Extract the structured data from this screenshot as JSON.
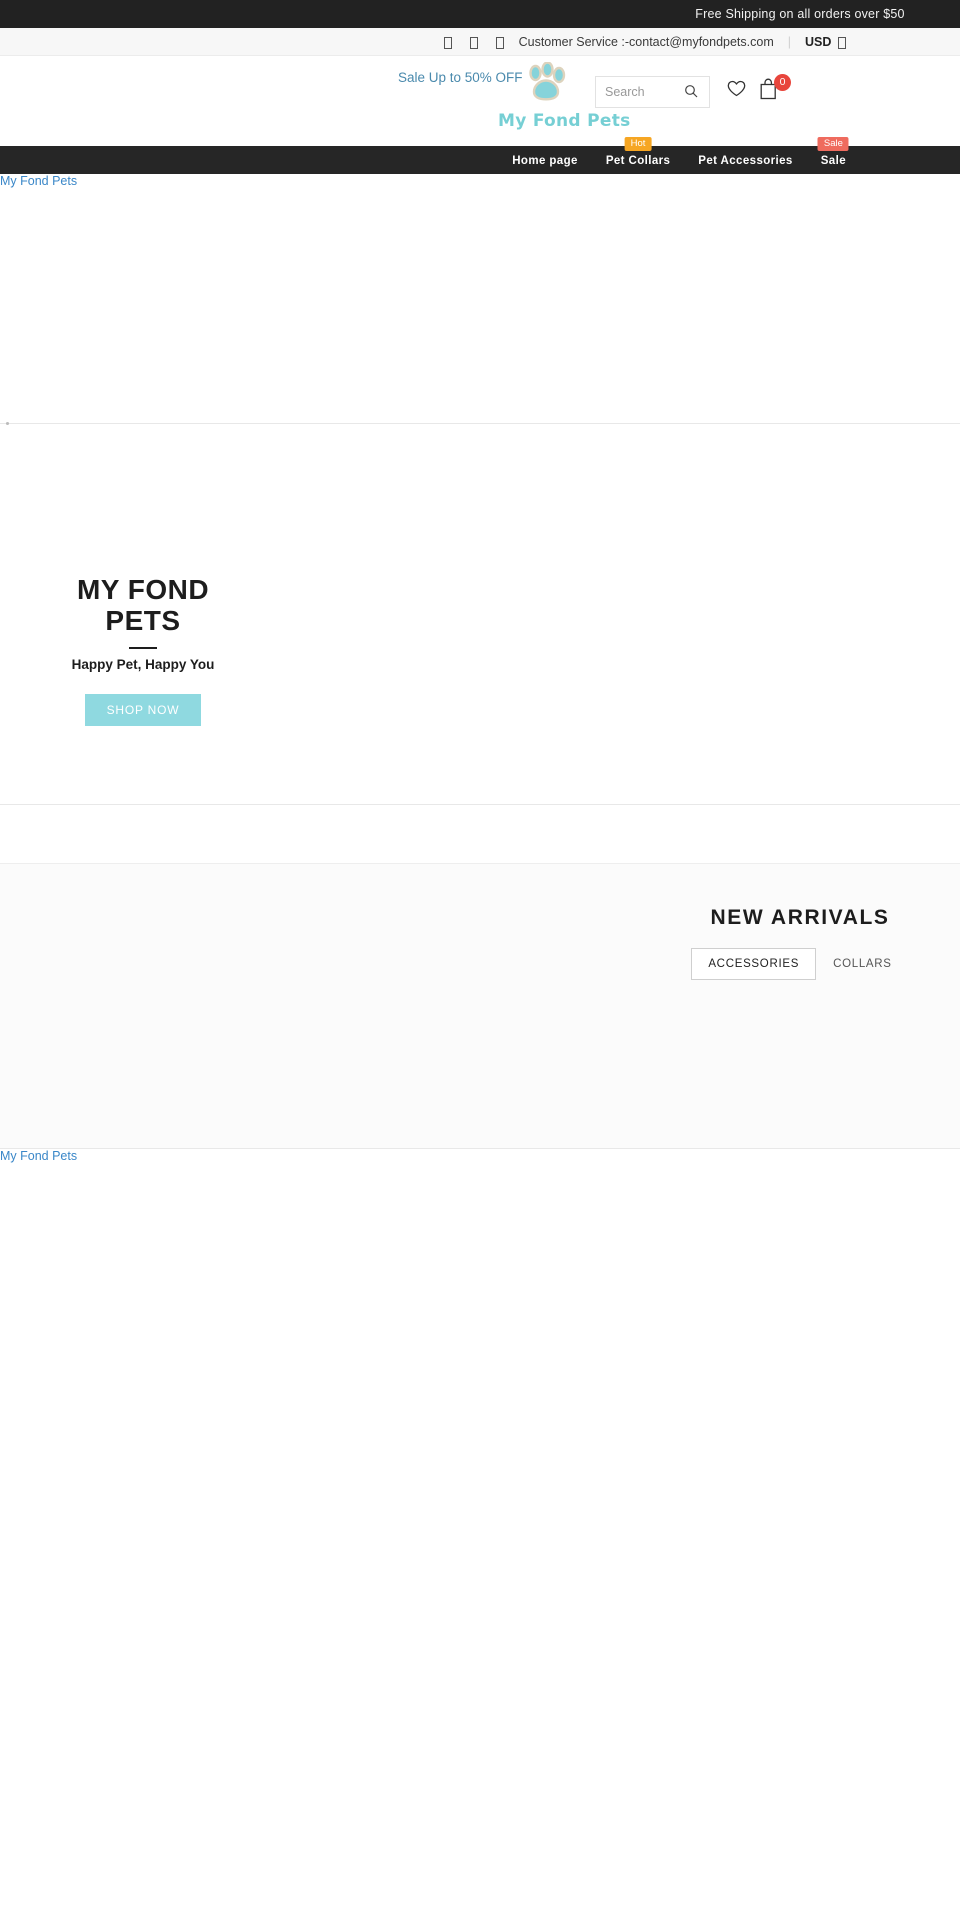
{
  "announcement": {
    "text": "Free Shipping on all orders over $50"
  },
  "topbar": {
    "social_icons": [
      "facebook-icon",
      "twitter-icon",
      "instagram-icon"
    ],
    "customer_service": "Customer Service :-contact@myfondpets.com",
    "separator": "|",
    "currency": "USD",
    "currency_caret": "caret-down-icon"
  },
  "header": {
    "sale_note": "Sale Up to 50% OFF",
    "brand_name": "My Fond Pets",
    "logo_icon": "paw-print-icon",
    "logo_color": "#76cfd4",
    "logo_outline_color": "#ddd3bd",
    "search": {
      "placeholder": "Search",
      "value": "",
      "icon": "search-icon"
    },
    "wishlist_icon": "heart-icon",
    "cart_icon": "shopping-bag-icon",
    "cart_count": "0",
    "cart_badge_color": "#e8453c"
  },
  "nav": {
    "items": [
      {
        "label": "Home page",
        "badge": null,
        "badge_kind": null
      },
      {
        "label": "Pet Collars",
        "badge": "Hot",
        "badge_kind": "hot"
      },
      {
        "label": "Pet Accessories",
        "badge": null,
        "badge_kind": null
      },
      {
        "label": "Sale",
        "badge": "Sale",
        "badge_kind": "sale"
      }
    ],
    "badge_hot_color": "#f6a623",
    "badge_sale_color": "#ef6b5e"
  },
  "hero": {
    "image_alt": "My Fond Pets",
    "title": "MY FOND PETS",
    "subtitle": "Happy Pet, Happy You",
    "button_label": "SHOP NOW",
    "button_color": "#8fd9e0"
  },
  "arrivals": {
    "title": "NEW ARRIVALS",
    "tabs": [
      {
        "label": "ACCESSORIES",
        "active": true
      },
      {
        "label": "COLLARS",
        "active": false
      }
    ]
  },
  "lower": {
    "image_alt": "My Fond Pets"
  }
}
